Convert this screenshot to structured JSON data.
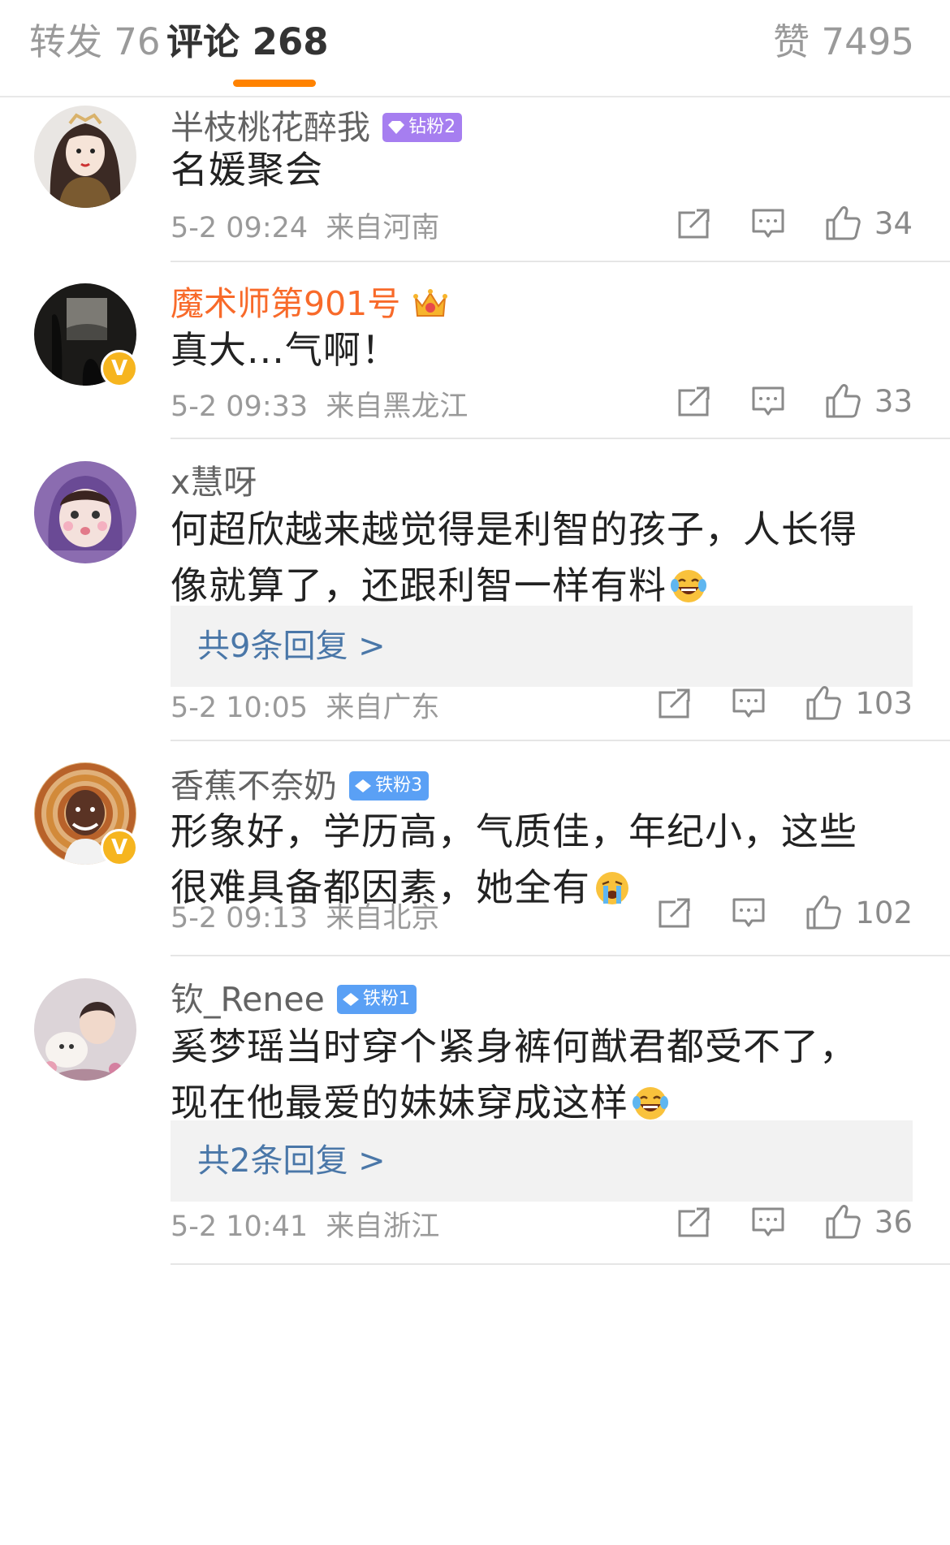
{
  "tabs": {
    "repost": "转发 76",
    "comments": "评论 268",
    "likes": "赞 7495"
  },
  "colors": {
    "accent": "#ff8200",
    "vip_name": "#f86a2a",
    "reply_link": "#4a77a8",
    "diamond_badge": "#a67ef0",
    "iron_badge": "#5aa0f5",
    "verified": "#f6b51f"
  },
  "comments": [
    {
      "username": "半枝桃花醉我",
      "badge": "钻粉2",
      "text_lines": [
        "名媛聚会"
      ],
      "time": "5-2 09:24",
      "location": "来自河南",
      "likes": "34",
      "icons": [
        "share-icon",
        "comment-icon",
        "thumbs-up-icon"
      ]
    },
    {
      "username": "魔术师第901号",
      "badge_icon": "crown-icon",
      "text_lines": [
        "真大...气啊！"
      ],
      "time": "5-2 09:33",
      "location": "来自黑龙江",
      "likes": "33"
    },
    {
      "username": "x慧呀",
      "text_lines": [
        "何超欣越来越觉得是利智的孩子，人长得",
        "像就算了，还跟利智一样有料"
      ],
      "emoji": "laugh-cry-emoji",
      "replies": "共9条回复 >",
      "time": "5-2 10:05",
      "location": "来自广东",
      "likes": "103"
    },
    {
      "username": "香蕉不奈奶",
      "badge": "铁粉3",
      "text_lines": [
        "形象好，学历高，气质佳，年纪小，这些",
        "很难具备都因素，她全有"
      ],
      "emoji": "crying-emoji",
      "time": "5-2 09:13",
      "location": "来自北京",
      "likes": "102"
    },
    {
      "username": "钦_Renee",
      "badge": "铁粉1",
      "text_lines": [
        "奚梦瑶当时穿个紧身裤何猷君都受不了，",
        "现在他最爱的妹妹穿成这样"
      ],
      "emoji": "laugh-cry-emoji",
      "replies": "共2条回复 >",
      "time": "5-2 10:41",
      "location": "来自浙江",
      "likes": "36"
    }
  ]
}
